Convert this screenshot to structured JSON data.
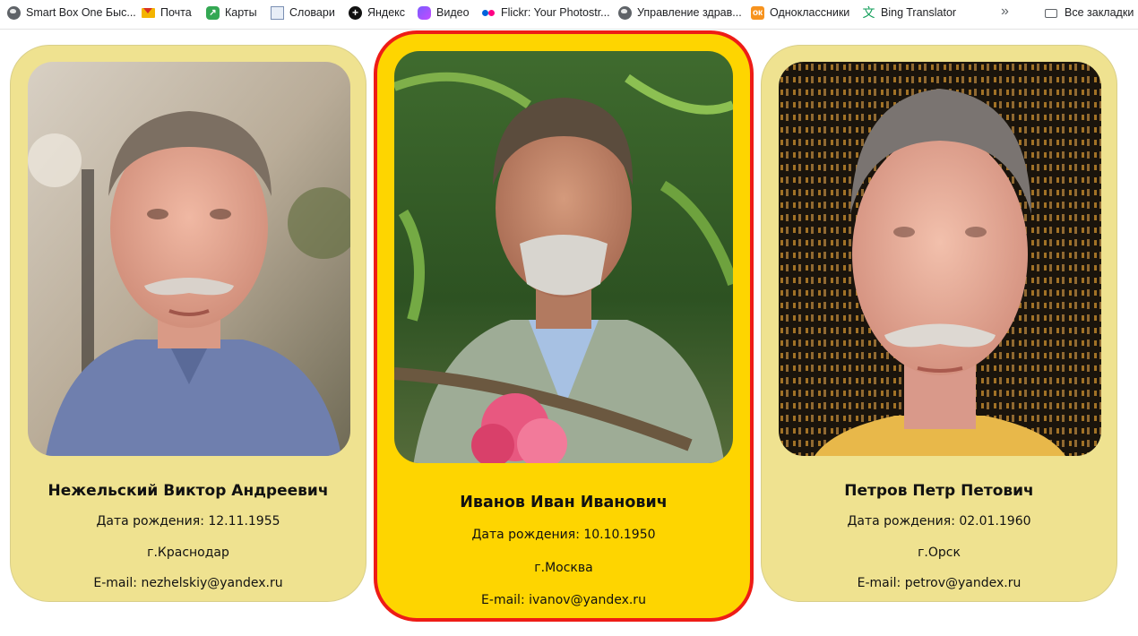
{
  "bookmarks": {
    "items": [
      {
        "label": "Smart Box One Быс...",
        "icon": "globe-icon"
      },
      {
        "label": "Почта",
        "icon": "mail-icon"
      },
      {
        "label": "Карты",
        "icon": "maps-icon"
      },
      {
        "label": "Словари",
        "icon": "dictionary-icon"
      },
      {
        "label": "Яндекс",
        "icon": "yandex-icon"
      },
      {
        "label": "Видео",
        "icon": "video-icon"
      },
      {
        "label": "Flickr: Your Photostr...",
        "icon": "flickr-icon"
      },
      {
        "label": "Управление здрав...",
        "icon": "globe-icon"
      },
      {
        "label": "Одноклассники",
        "icon": "odnoklassniki-icon"
      },
      {
        "label": "Bing Translator",
        "icon": "bing-translator-icon"
      }
    ],
    "overflow": "»",
    "all_bookmarks": "Все закладки"
  },
  "people": [
    {
      "name": "Нежельский Виктор Андреевич",
      "birth": "Дата рождения: 12.11.1955",
      "city": "г.Краснодар",
      "email": "E-mail: nezhelskiy@yandex.ru"
    },
    {
      "name": "Иванов Иван Иванович",
      "birth": "Дата рождения: 10.10.1950",
      "city": "г.Москва",
      "email": "E-mail: ivanov@yandex.ru"
    },
    {
      "name": "Петров Петр Петович",
      "birth": "Дата рождения: 02.01.1960",
      "city": "г.Орск",
      "email": "E-mail: petrov@yandex.ru"
    }
  ],
  "colors": {
    "card_bg": "#efe290",
    "card_selected_bg": "#fed500",
    "card_selected_border": "#ee1c16"
  }
}
